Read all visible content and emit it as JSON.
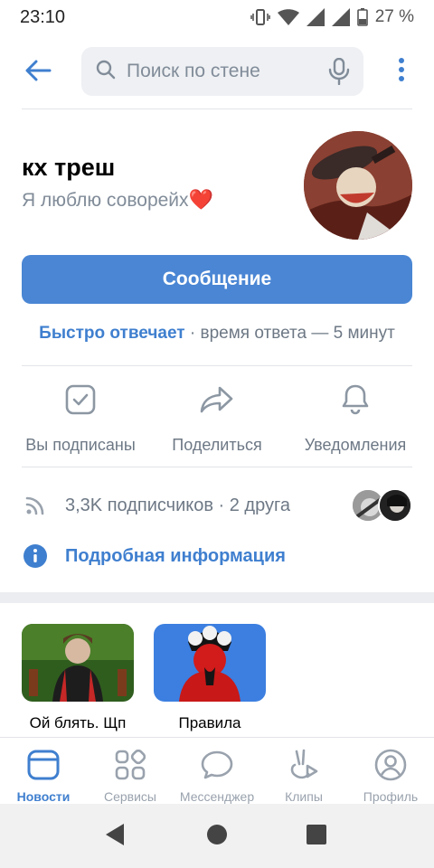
{
  "status_bar": {
    "time": "23:10",
    "battery": "27 %"
  },
  "search": {
    "placeholder": "Поиск по стене"
  },
  "profile": {
    "name": "кх треш",
    "status": "Я люблю соворейх",
    "status_emoji": "❤️",
    "message_button": "Сообщение",
    "reply_fast": "Быстро отвечает",
    "reply_time": " · время ответа — 5 минут"
  },
  "actions": [
    {
      "label": "Вы подписаны",
      "icon": "check-square-icon"
    },
    {
      "label": "Поделиться",
      "icon": "share-icon"
    },
    {
      "label": "Уведомления",
      "icon": "bell-icon"
    }
  ],
  "followers": {
    "text": "3,3K подписчиков · 2 друга"
  },
  "info": {
    "label": "Подробная информация"
  },
  "albums": [
    {
      "caption": "Ой блять. Щп"
    },
    {
      "caption": "Правила"
    }
  ],
  "bottom_nav": [
    {
      "label": "Новости",
      "icon": "news-icon",
      "active": true
    },
    {
      "label": "Сервисы",
      "icon": "services-icon"
    },
    {
      "label": "Мессенджер",
      "icon": "messenger-icon"
    },
    {
      "label": "Клипы",
      "icon": "clips-icon"
    },
    {
      "label": "Профиль",
      "icon": "profile-icon"
    }
  ],
  "colors": {
    "accent": "#4a86d4",
    "link": "#3f7fcf",
    "secondary": "#818c99"
  }
}
